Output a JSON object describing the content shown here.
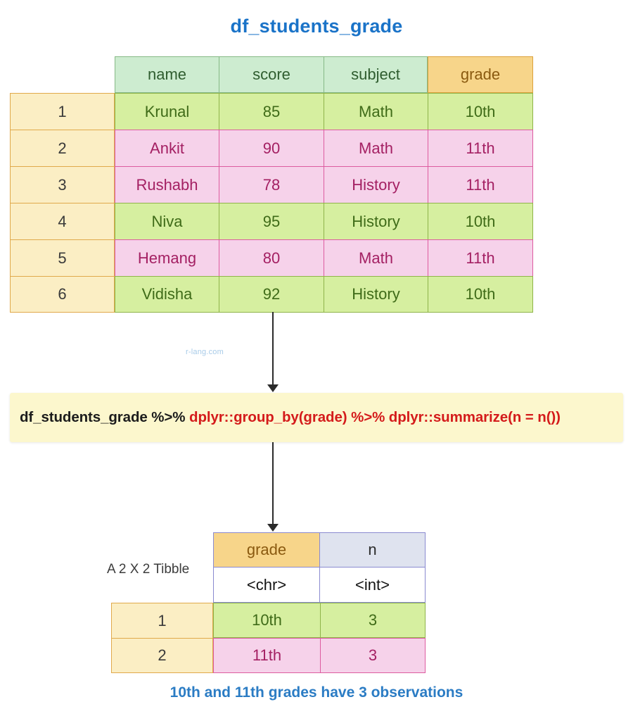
{
  "title": "df_students_grade",
  "watermark": "r-lang.com",
  "source_table": {
    "headers": [
      "name",
      "score",
      "subject",
      "grade"
    ],
    "key_column": "grade",
    "rows": [
      {
        "index": "1",
        "name": "Krunal",
        "score": "85",
        "subject": "Math",
        "grade": "10th",
        "style": "green"
      },
      {
        "index": "2",
        "name": "Ankit",
        "score": "90",
        "subject": "Math",
        "grade": "11th",
        "style": "pink"
      },
      {
        "index": "3",
        "name": "Rushabh",
        "score": "78",
        "subject": "History",
        "grade": "11th",
        "style": "pink"
      },
      {
        "index": "4",
        "name": "Niva",
        "score": "95",
        "subject": "History",
        "grade": "10th",
        "style": "green"
      },
      {
        "index": "5",
        "name": "Hemang",
        "score": "80",
        "subject": "Math",
        "grade": "11th",
        "style": "pink"
      },
      {
        "index": "6",
        "name": "Vidisha",
        "score": "92",
        "subject": "History",
        "grade": "10th",
        "style": "green"
      }
    ]
  },
  "code": {
    "plain_part": "df_students_grade %>% ",
    "highlight_part": "dplyr::group_by(grade) %>% dplyr::summarize(n = n())",
    "full": "df_students_grade %>% dplyr::group_by(grade) %>% dplyr::summarize(n = n())"
  },
  "result": {
    "label": "A 2 X 2 Tibble",
    "headers": [
      "grade",
      "n"
    ],
    "types": [
      "<chr>",
      "<int>"
    ],
    "rows": [
      {
        "index": "1",
        "grade": "10th",
        "n": "3",
        "style": "green"
      },
      {
        "index": "2",
        "grade": "11th",
        "n": "3",
        "style": "pink"
      }
    ]
  },
  "caption": "10th and 11th grades have 3 observations",
  "colors": {
    "title_blue": "#1a73c8",
    "caption_blue": "#2b7cc4",
    "header_green": "#cdecd0",
    "key_amber": "#f7d58a",
    "row_green": "#d6efa0",
    "row_pink": "#f6d2ea",
    "index_cream": "#fbeec4",
    "code_bg": "#fcf7cd",
    "code_red": "#d41b1b",
    "tibble_n_header": "#dfe3ef"
  }
}
